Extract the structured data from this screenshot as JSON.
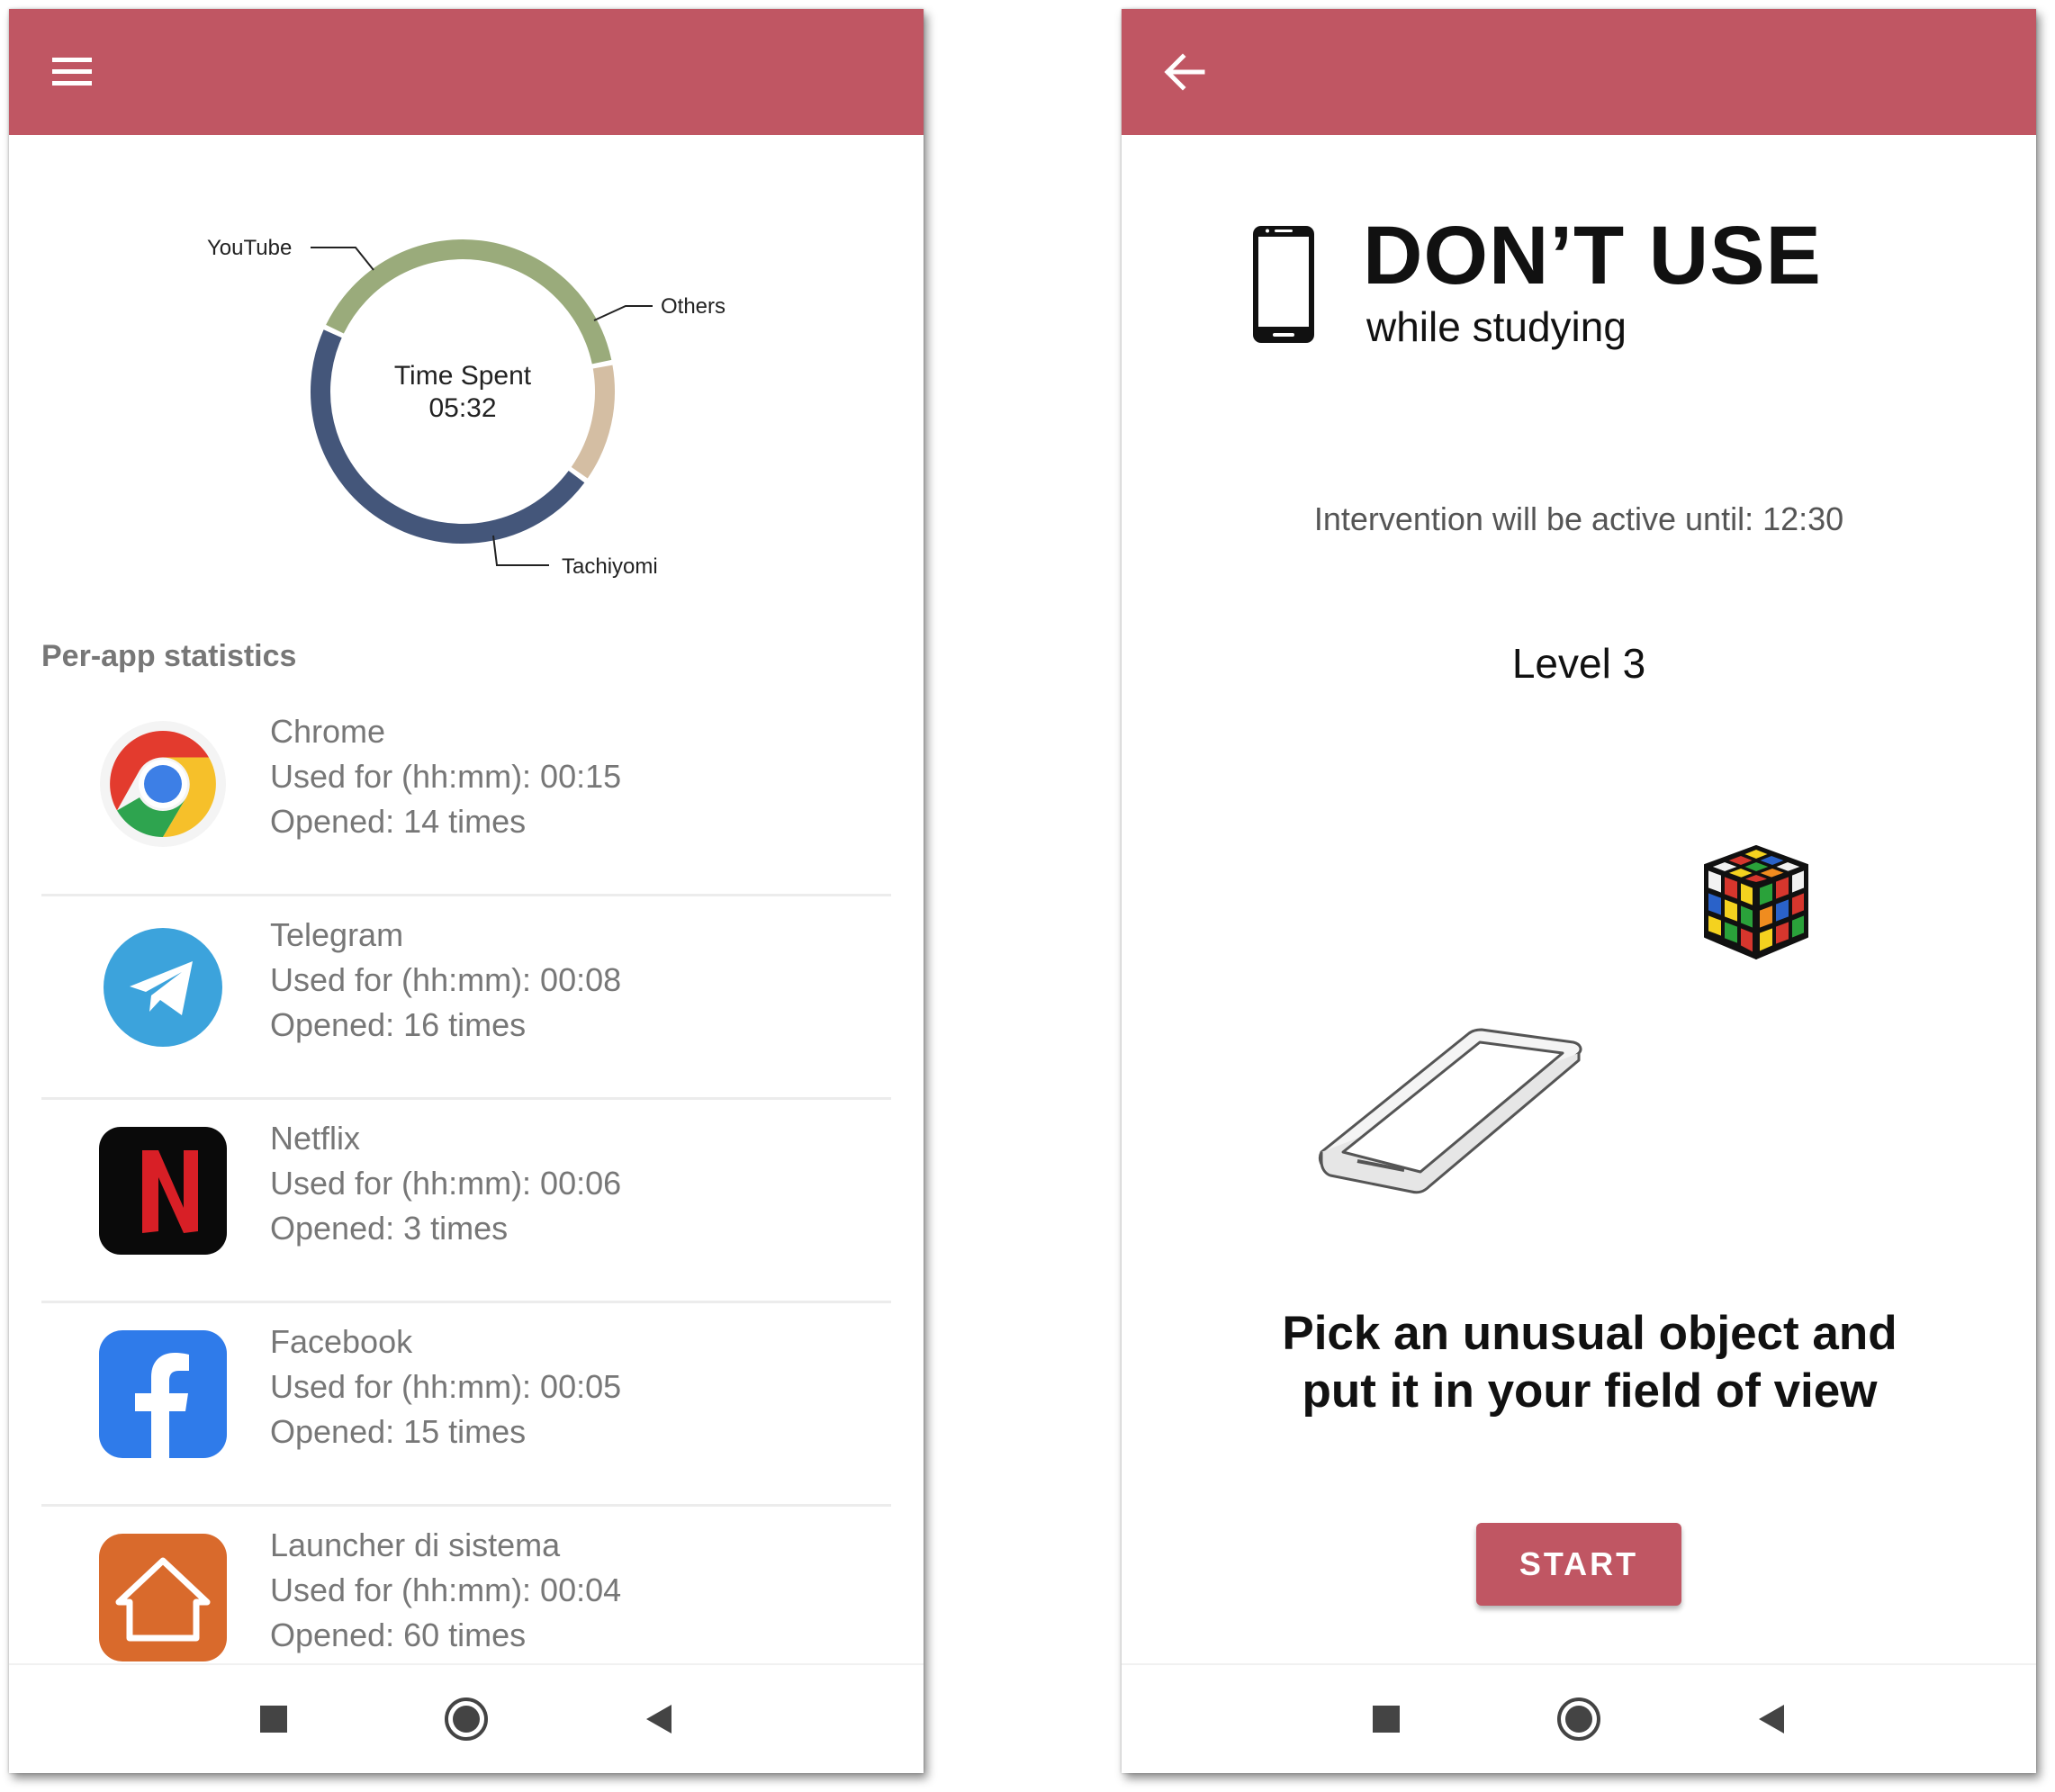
{
  "left_screen": {
    "menu_icon": "hamburger-menu-icon",
    "chart_data": {
      "type": "pie",
      "center_label": "Time Spent",
      "center_value": "05:32",
      "slices": [
        {
          "label": "YouTube",
          "fraction": 0.4,
          "color": "#9aab7b"
        },
        {
          "label": "Others",
          "fraction": 0.13,
          "color": "#d4bea3"
        },
        {
          "label": "Tachiyomi",
          "fraction": 0.47,
          "color": "#44567a"
        }
      ]
    },
    "section_title": "Per-app statistics",
    "apps": [
      {
        "name": "Chrome",
        "usage": "Used for (hh:mm): 00:15",
        "opened": "Opened: 14 times",
        "icon": "chrome-icon"
      },
      {
        "name": "Telegram",
        "usage": "Used for (hh:mm): 00:08",
        "opened": "Opened: 16 times",
        "icon": "telegram-icon"
      },
      {
        "name": "Netflix",
        "usage": "Used for (hh:mm): 00:06",
        "opened": "Opened: 3 times",
        "icon": "netflix-icon"
      },
      {
        "name": "Facebook",
        "usage": "Used for (hh:mm): 00:05",
        "opened": "Opened: 15 times",
        "icon": "facebook-icon"
      },
      {
        "name": "Launcher di sistema",
        "usage": "Used for (hh:mm): 00:04",
        "opened": "Opened: 60 times",
        "icon": "home-icon"
      }
    ],
    "nav": [
      "recents-square-icon",
      "home-circle-icon",
      "back-triangle-icon"
    ]
  },
  "right_screen": {
    "back_icon": "back-arrow-icon",
    "title": "DON’T USE",
    "subtitle": "while studying",
    "intervention": "Intervention will be active until: 12:30",
    "level": "Level 3",
    "instruction_line1": "Pick an unusual object and",
    "instruction_line2": "put it in your field of view",
    "start_label": "START",
    "nav": [
      "recents-square-icon",
      "home-circle-icon",
      "back-triangle-icon"
    ]
  },
  "colors": {
    "accent": "#c05663",
    "youtube": "#9aab7b",
    "others": "#d4bea3",
    "tachiyomi": "#44567a"
  }
}
